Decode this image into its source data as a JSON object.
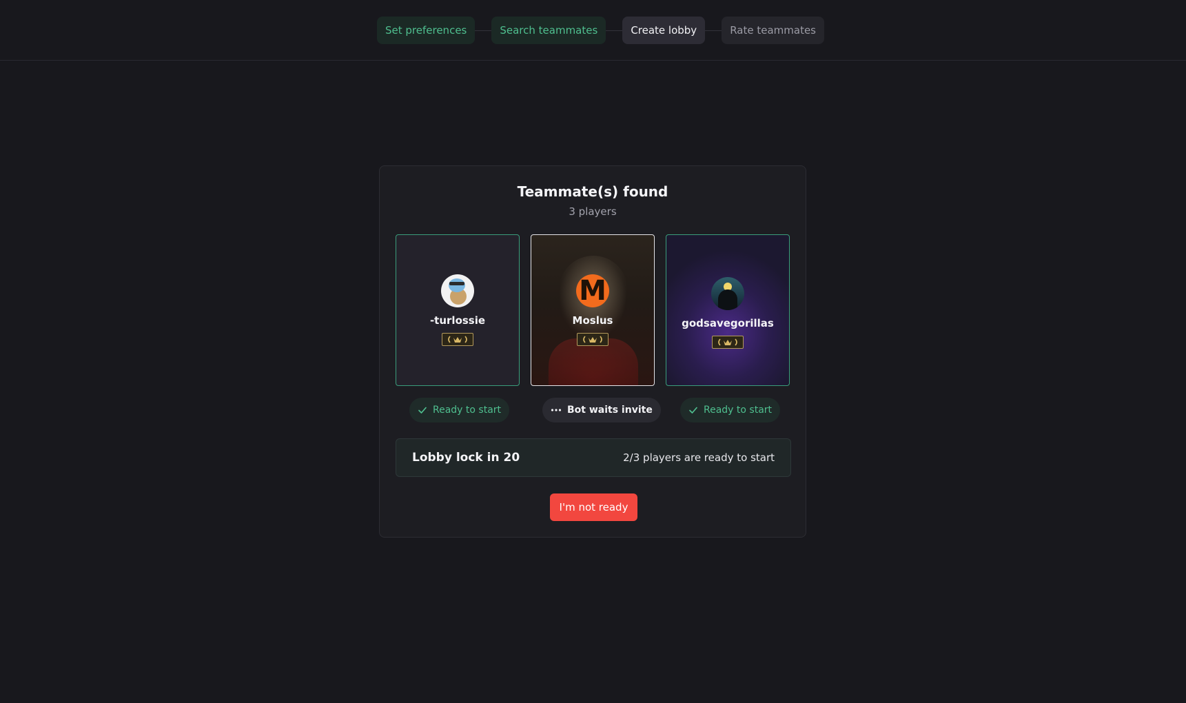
{
  "stepper": {
    "steps": [
      {
        "label": "Set preferences",
        "state": "done"
      },
      {
        "label": "Search teammates",
        "state": "done"
      },
      {
        "label": "Create lobby",
        "state": "current"
      },
      {
        "label": "Rate teammates",
        "state": "todo"
      }
    ]
  },
  "card": {
    "title": "Teammate(s) found",
    "subtitle": "3 players"
  },
  "players": [
    {
      "name": "-turlossie",
      "avatar_icon": "squirtle-avatar-icon",
      "rank_icon": "rank-laurel-icon",
      "status": "Ready to start",
      "status_icon": "check-icon",
      "status_state": "ready"
    },
    {
      "name": "Moslus",
      "avatar_icon": "m-logo-avatar-icon",
      "rank_icon": "rank-laurel-icon",
      "status": "Bot waits invite",
      "status_icon": "ellipsis-icon",
      "status_state": "waiting"
    },
    {
      "name": "godsavegorillas",
      "avatar_icon": "night-figure-avatar-icon",
      "rank_icon": "rank-laurel-icon",
      "status": "Ready to start",
      "status_icon": "check-icon",
      "status_state": "ready"
    }
  ],
  "lobby": {
    "lock_text": "Lobby lock in 20",
    "ready_text": "2/3 players are ready to start"
  },
  "actions": {
    "not_ready_label": "I'm not ready"
  },
  "colors": {
    "background": "#18181d",
    "accent_green": "#4fbf8f",
    "danger": "#f2473f"
  }
}
